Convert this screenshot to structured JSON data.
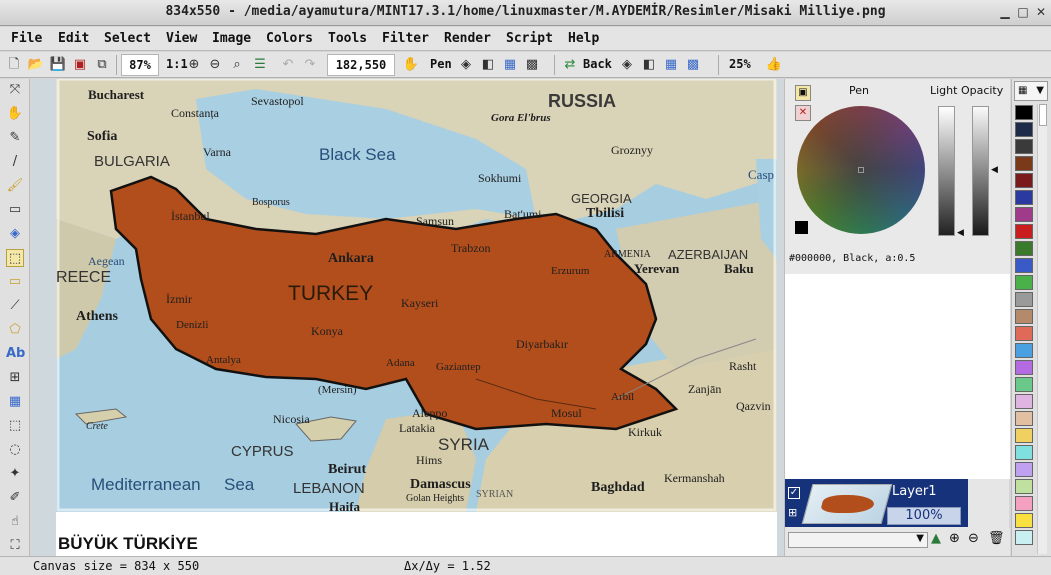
{
  "window": {
    "title": "834x550 - /media/ayamutura/MINT17.3.1/home/linuxmaster/M.AYDEMİR/Resimler/Misaki Milliye.png",
    "minimize_icon": "minimize-icon",
    "maximize_icon": "maximize-icon",
    "close_icon": "close-icon"
  },
  "menu": [
    "File",
    "Edit",
    "Select",
    "View",
    "Image",
    "Colors",
    "Tools",
    "Filter",
    "Render",
    "Script",
    "Help"
  ],
  "toolbar": {
    "zoom": "87%",
    "ratio": "1:1",
    "coords": "182,550",
    "pen_label": "Pen",
    "back_label": "Back",
    "opacity": "25%"
  },
  "color_panel": {
    "pen_label": "Pen",
    "light_opacity_label": "Light Opacity",
    "color_readout": "#000000, Black, a:0.5"
  },
  "layers": {
    "name": "Layer1",
    "opacity": "100%"
  },
  "map": {
    "labels": {
      "bucharest": "Bucharest",
      "constanta": "Constanța",
      "sevastopol": "Sevastopol",
      "russia": "RUSSIA",
      "gora": "Gora El'brus",
      "sofia": "Sofia",
      "varna": "Varna",
      "blacksea": "Black Sea",
      "grozny": "Groznyy",
      "bulgaria": "BULGARIA",
      "sokhumi": "Sokhumi",
      "caspian": "Casp",
      "georgia": "GEORGIA",
      "tbilisi": "Tbilisi",
      "bosporus": "Bosporus",
      "samsun": "Samsun",
      "batumi": "Bat'umi",
      "istanbul": "İstanbul",
      "trabzon": "Trabzon",
      "azerbaijan": "AZERBAIJAN",
      "yerevan": "Yerevan",
      "baku": "Baku",
      "armenia": "ARMENIA",
      "erzurum": "Erzurum",
      "greece": "REECE",
      "aegean": "Aegean",
      "ankara": "Ankara",
      "turkey": "TURKEY",
      "izmir": "İzmir",
      "kayseri": "Kayseri",
      "athens": "Athens",
      "denizli": "Denizli",
      "konya": "Konya",
      "diyarbakir": "Diyarbakır",
      "antalya": "Antalya",
      "adana": "Adana",
      "gaziantep": "Gaziantep",
      "mersin": "(Mersin)",
      "rasht": "Rasht",
      "zanjan": "Zanjān",
      "aleppo": "Aleppo",
      "mosul": "Mosul",
      "arbil": "Arbīl",
      "qazvin": "Qazvin",
      "nicosia": "Nicosia",
      "latakia": "Latakia",
      "crete": "Crete",
      "cyprus": "CYPRUS",
      "syria": "SYRIA",
      "homs": "Hims",
      "kirkuk": "Kirkuk",
      "beirut": "Beirut",
      "lebanon": "LEBANON",
      "damascus": "Damascus",
      "kermanshah": "Kermanshah",
      "mediterranean": "Mediterranean",
      "sea": "Sea",
      "golan": "Golan Heights",
      "baghdad": "Baghdad",
      "haifa": "Haifa",
      "syrian": "SYRIAN"
    },
    "caption": "BÜYÜK TÜRKİYE"
  },
  "status": {
    "canvas_size": "Canvas size = 834 x 550",
    "delta": "Δx/Δy = 1.52"
  },
  "palette_colors": [
    "#000000",
    "#1e2a4a",
    "#3a3a3a",
    "#7a3a1a",
    "#7a1a1a",
    "#2a3aa0",
    "#a03a8a",
    "#c81e1e",
    "#3a7a2a",
    "#3a5ac8",
    "#4ab04a",
    "#9a9a9a",
    "#b48a6a",
    "#e06a5a",
    "#4aa0e0",
    "#b46ae0",
    "#6ac88a",
    "#e0b4e0",
    "#e0c0a0",
    "#f0d060",
    "#80e0e0",
    "#c0a0f0",
    "#c0e0a0",
    "#f4a0c0",
    "#f8e040",
    "#c8f0f0"
  ]
}
